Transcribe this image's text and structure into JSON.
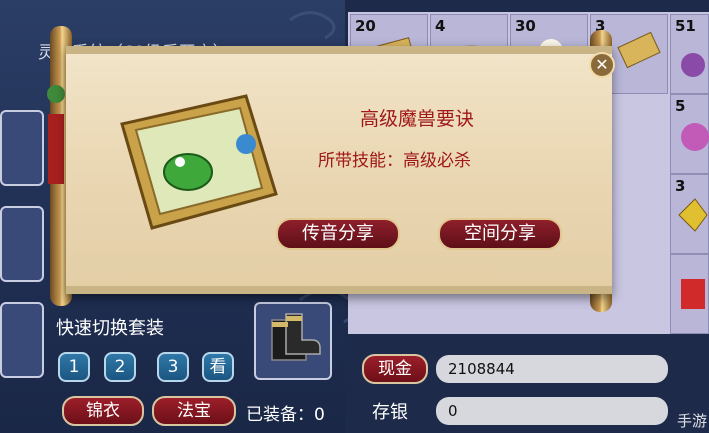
{
  "left_panel": {
    "system_title": "灵犀系统（60级后开启）",
    "quick_switch_label": "快速切换套装",
    "set_buttons": [
      "1",
      "2",
      "3"
    ],
    "view_button": "看",
    "brocade_button": "锦衣",
    "treasure_button": "法宝",
    "equipped_label": "已装备：0"
  },
  "inventory": {
    "counts": [
      "20",
      "4",
      "30",
      "3",
      "51",
      "5",
      "3"
    ]
  },
  "money": {
    "cash_button": "现金",
    "cash_value": "2108844",
    "savings_label": "存银",
    "savings_value": "0"
  },
  "popup": {
    "item_name": "高级魔兽要诀",
    "item_skill": "所带技能：高级必杀",
    "share_voice_button": "传音分享",
    "share_space_button": "空间分享",
    "close_symbol": "✕"
  },
  "watermark": "手游",
  "colors": {
    "scroll_paper": "#ead7b3",
    "item_text": "#a01818",
    "button_red": "#8e1f2b"
  }
}
